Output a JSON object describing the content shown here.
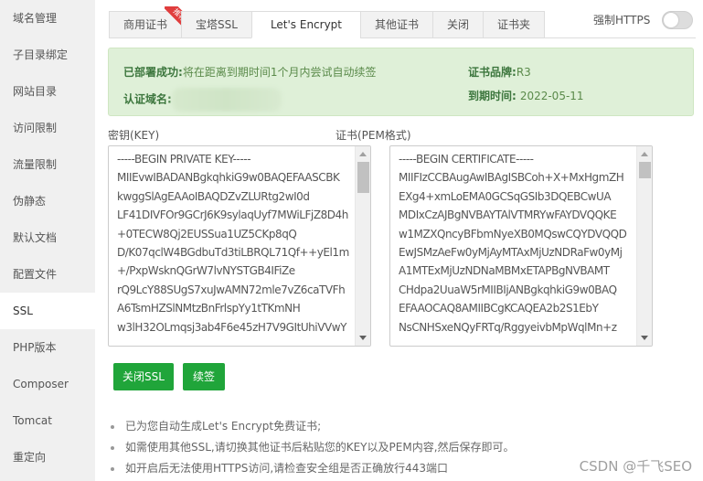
{
  "sidebar": {
    "items": [
      {
        "label": "域名管理"
      },
      {
        "label": "子目录绑定"
      },
      {
        "label": "网站目录"
      },
      {
        "label": "访问限制"
      },
      {
        "label": "流量限制"
      },
      {
        "label": "伪静态"
      },
      {
        "label": "默认文档"
      },
      {
        "label": "配置文件"
      },
      {
        "label": "SSL",
        "active": true
      },
      {
        "label": "PHP版本"
      },
      {
        "label": "Composer"
      },
      {
        "label": "Tomcat"
      },
      {
        "label": "重定向"
      }
    ]
  },
  "tabs": [
    {
      "label": "商用证书",
      "badge": "推荐"
    },
    {
      "label": "宝塔SSL"
    },
    {
      "label": "Let's Encrypt",
      "active": true
    },
    {
      "label": "其他证书"
    },
    {
      "label": "关闭"
    },
    {
      "label": "证书夹"
    }
  ],
  "force_https": {
    "label": "强制HTTPS",
    "enabled": false
  },
  "status": {
    "deployed_label": "已部署成功:",
    "deployed_text": "将在距离到期时间1个月内尝试自动续签",
    "domain_label": "认证域名:",
    "domain_value": "",
    "brand_label": "证书品牌:",
    "brand_value": "R3",
    "expire_label": "到期时间:",
    "expire_value": "2022-05-11"
  },
  "key": {
    "label": "密钥(KEY)",
    "lines": "-----BEGIN PRIVATE KEY-----\nMIIEvwIBADANBgkqhkiG9w0BAQEFAASCBK\nkwggSlAgEAAoIBAQDZvZLURtg2wI0d\nLF41DIVFOr9GCrJ6K9sylaqUyf7MWiLFjZ8D4h\n+0TECW8Qj2EUSSua1UZ5CKp8qQ\nD/K07qclW4BGdbuTd3tiLBRQL71Qf++yEl1m\n+/PxpWsknQGrW7lvNYSTGB4IFiZe\nrQ9LcY88SUgS7xuJwAMN72mle7vZ6caTVFh\nA6TsmHZSlNMtzBnFrlspYy1tTKmNH\nw3lH32OLmqsj3ab4F6e45zH7V9GItUhiVVwY"
  },
  "cert": {
    "label": "证书(PEM格式)",
    "lines": "-----BEGIN CERTIFICATE-----\nMIIFIzCCBAugAwIBAgISBCoh+X+MxHgmZH\nEXg4+xmLoEMA0GCSqGSIb3DQEBCwUA\nMDIxCzAJBgNVBAYTAlVTMRYwFAYDVQQKE\nw1MZXQncyBFbmNyeXB0MQswCQYDVQQD\nEwJSMzAeFw0yMjAyMTAxMjUzNDRaFw0yMj\nA1MTExMjUzNDNaMBMxETAPBgNVBAMT\nCHdpa2UuaW5rMIIBIjANBgkqhkiG9w0BAQ\nEFAAOCAQ8AMIIBCgKCAQEA2b2S1EbY\nNsCNHSxeNQyFRTq/RggyeivbMpWqlMn+z"
  },
  "buttons": {
    "close_ssl": "关闭SSL",
    "renew": "续签"
  },
  "help": [
    "已为您自动生成Let's Encrypt免费证书;",
    "如需使用其他SSL,请切换其他证书后粘贴您的KEY以及PEM内容,然后保存即可。",
    "如开启后无法使用HTTPS访问,请检查安全组是否正确放行443端口"
  ],
  "watermark": "CSDN @千飞SEO",
  "colors": {
    "accent_green": "#20a53a",
    "success_bg": "#dff0d8",
    "success_text": "#3c763d",
    "badge_red": "#e03d3d"
  }
}
